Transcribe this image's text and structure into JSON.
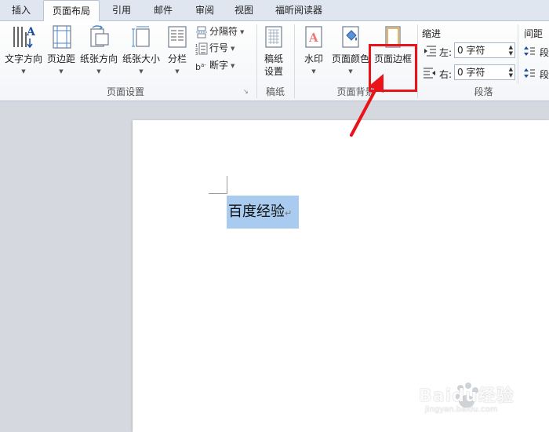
{
  "tabs": [
    {
      "label": "插入"
    },
    {
      "label": "页面布局",
      "active": true
    },
    {
      "label": "引用"
    },
    {
      "label": "邮件"
    },
    {
      "label": "审阅"
    },
    {
      "label": "视图"
    },
    {
      "label": "福昕阅读器"
    }
  ],
  "ribbon": {
    "page_setup": {
      "label": "页面设置",
      "text_direction": "文字方向",
      "margins": "页边距",
      "orientation": "纸张方向",
      "size": "纸张大小",
      "columns": "分栏",
      "breaks": "分隔符",
      "line_numbers": "行号",
      "hyphenation": "断字"
    },
    "manuscript": {
      "label": "稿纸",
      "settings_line1": "稿纸",
      "settings_line2": "设置"
    },
    "page_background": {
      "label": "页面背景",
      "watermark": "水印",
      "page_color": "页面颜色",
      "page_borders": "页面边框"
    },
    "paragraph": {
      "label": "段落",
      "indent_title": "缩进",
      "left_label": "左:",
      "left_value": "0 字符",
      "right_label": "右:",
      "right_value": "0 字符",
      "spacing_title": "间距",
      "before_label": "段",
      "after_label": "段"
    }
  },
  "document": {
    "text": "百度经验",
    "para_mark": "↵"
  },
  "watermark": {
    "brand": "Baidu经验",
    "url": "jingyan.baidu.com"
  },
  "colors": {
    "highlight_box": "#e8141a",
    "selection": "#a8cbef",
    "active_tab_bg": "#fdfdfe"
  }
}
